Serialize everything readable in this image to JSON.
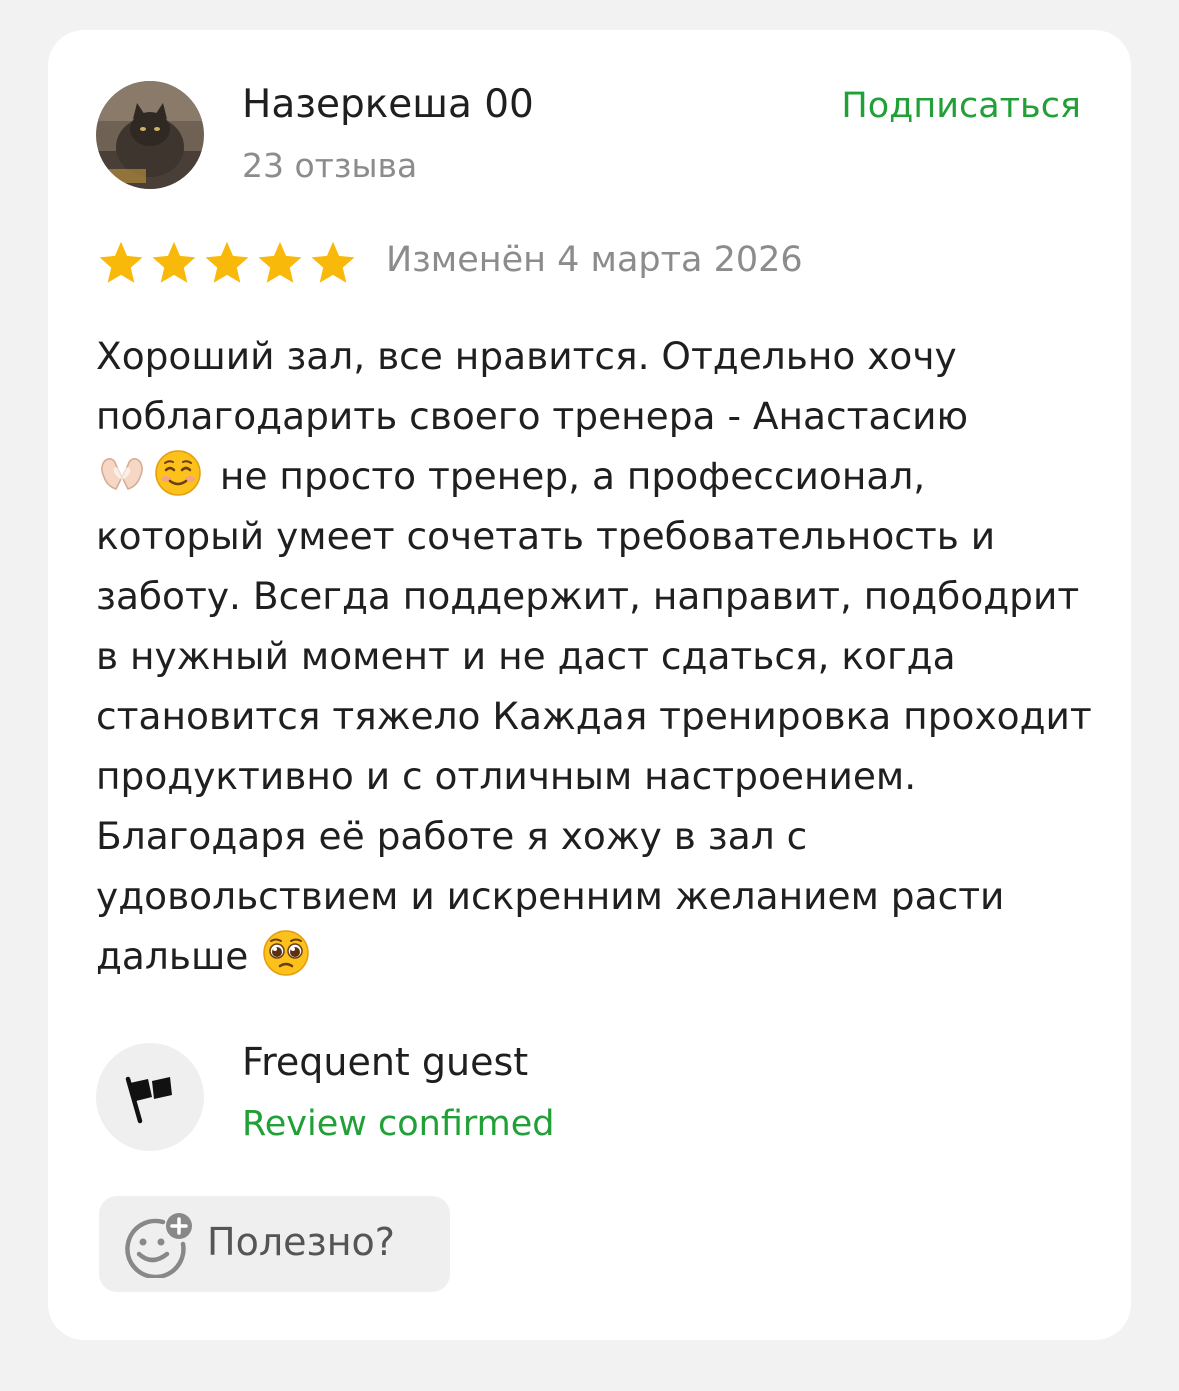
{
  "colors": {
    "accent_green": "#21a038",
    "star_gold": "#f9b90b",
    "muted_text": "#8c8c8c",
    "primary_text": "#1f1f1f"
  },
  "author": {
    "name": "Назеркеша 00",
    "reviews_count": "23 отзыва",
    "subscribe_label": "Подписаться",
    "avatar_icon": "cat-photo-avatar"
  },
  "rating": {
    "stars": 5,
    "max_stars": 5,
    "edited_label": "Изменён 4 марта 2026"
  },
  "review": {
    "part1": "Хороший зал, все нравится. Отдельно хочу поблагодарить своего тренера - Анастасию",
    "emoji1": "heart-hands-emoji",
    "emoji2": "smiling-face-emoji",
    "part2": "не просто тренер, а профессионал, который умеет сочетать требовательность и заботу. Всегда поддержит, направит, подбодрит в нужный момент и не даст сдаться, когда становится тяжело Каждая тренировка проходит продуктивно и с отличным настроением. Благодаря её работе я хожу в зал с удовольствием и искренним желанием расти дальше",
    "emoji3": "pleading-face-emoji"
  },
  "badge": {
    "icon": "flag-icon",
    "title": "Frequent guest",
    "status": "Review confirmed"
  },
  "helpful": {
    "icon": "smiley-plus-icon",
    "label": "Полезно?"
  }
}
